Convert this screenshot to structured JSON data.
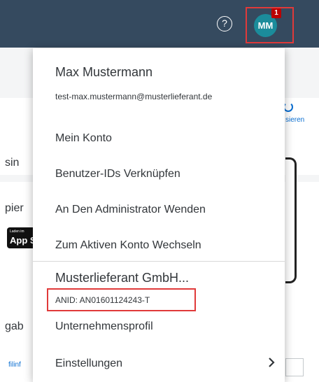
{
  "topbar": {
    "help_icon": "?",
    "avatar_initials": "MM",
    "notification_count": "1",
    "accent_color": "#354a5f"
  },
  "background": {
    "text_1": "sin",
    "text_2": "pier",
    "appstore_small": "Laden im",
    "appstore_big": "App S",
    "refresh_label": "sieren",
    "text_3": "gab",
    "link_1": "filinf"
  },
  "menu": {
    "user": {
      "name": "Max Mustermann",
      "email": "test-max.mustermann@musterlieferant.de"
    },
    "items": [
      {
        "label": "Mein Konto"
      },
      {
        "label": "Benutzer-IDs Verknüpfen"
      },
      {
        "label": "An Den Administrator Wenden"
      },
      {
        "label": "Zum Aktiven Konto Wechseln"
      }
    ],
    "company": {
      "name": "Musterlieferant GmbH...",
      "anid": "ANID: AN01601124243-T"
    },
    "company_items": [
      {
        "label": "Unternehmensprofil"
      },
      {
        "label": "Einstellungen"
      }
    ]
  }
}
